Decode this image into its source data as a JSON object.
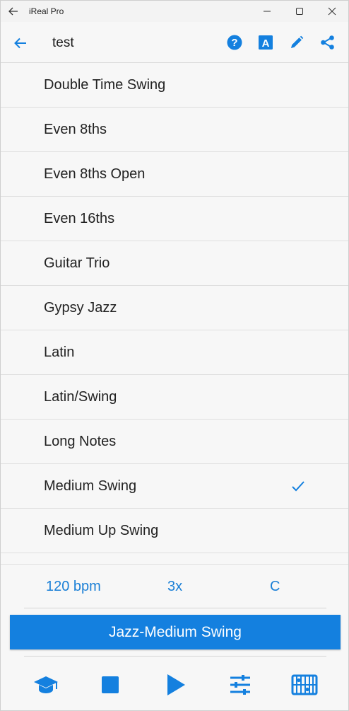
{
  "window": {
    "title": "iReal Pro"
  },
  "header": {
    "title": "test"
  },
  "styles": [
    {
      "label": "Double Time Swing",
      "selected": false
    },
    {
      "label": "Even 8ths",
      "selected": false
    },
    {
      "label": "Even 8ths Open",
      "selected": false
    },
    {
      "label": "Even 16ths",
      "selected": false
    },
    {
      "label": "Guitar Trio",
      "selected": false
    },
    {
      "label": "Gypsy Jazz",
      "selected": false
    },
    {
      "label": "Latin",
      "selected": false
    },
    {
      "label": "Latin/Swing",
      "selected": false
    },
    {
      "label": "Long Notes",
      "selected": false
    },
    {
      "label": "Medium Swing",
      "selected": true
    },
    {
      "label": "Medium Up Swing",
      "selected": false
    }
  ],
  "params": {
    "tempo": "120 bpm",
    "repeats": "3x",
    "key": "C"
  },
  "selected_style_button": "Jazz-Medium Swing",
  "colors": {
    "accent": "#1480df",
    "text": "#222222",
    "divider": "#dedede"
  },
  "icons": {
    "titlebar": [
      "back-arrow-icon",
      "minimize-icon",
      "maximize-icon",
      "close-icon"
    ],
    "header": [
      "back-arrow-icon",
      "help-icon",
      "font-icon",
      "edit-pencil-icon",
      "share-icon"
    ],
    "bottom": [
      "graduation-cap-icon",
      "stop-icon",
      "play-icon",
      "mixer-sliders-icon",
      "fretboard-icon"
    ]
  }
}
